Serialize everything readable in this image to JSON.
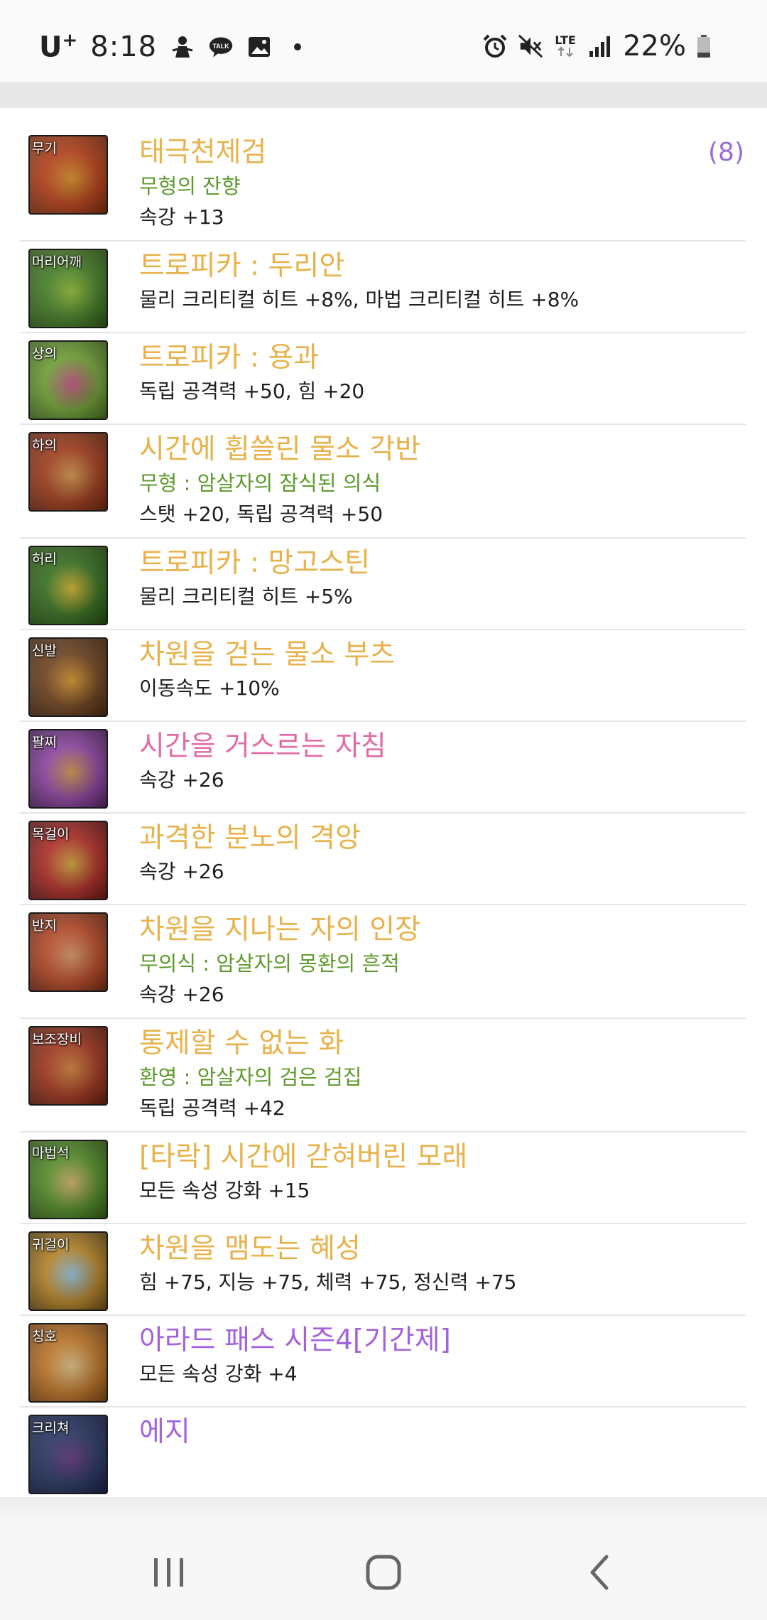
{
  "status_bar": {
    "carrier": "U",
    "carrier_sup": "+",
    "time": "8:18",
    "battery": "22%",
    "network": "LTE"
  },
  "equipment": [
    {
      "slot": "무기",
      "name": "태극천제검",
      "name_color": "gold",
      "sub": "무형의 잔향",
      "stat": "속강 +13",
      "count": "(8)",
      "icon_colors": [
        "#c8451a",
        "#e89a2a",
        "#6b2a10"
      ]
    },
    {
      "slot": "머리어깨",
      "name": "트로피카 : 두리안",
      "name_color": "gold",
      "stat": "물리 크리티컬 히트 +8%, 마법 크리티컬 히트 +8%",
      "icon_colors": [
        "#4a8a2a",
        "#9ccc3a",
        "#2a4a12"
      ]
    },
    {
      "slot": "상의",
      "name": "트로피카 : 용과",
      "name_color": "gold",
      "stat": "독립 공격력 +50, 힘 +20",
      "icon_colors": [
        "#7ab03a",
        "#d65a8a",
        "#3a5a1a"
      ]
    },
    {
      "slot": "하의",
      "name": "시간에 휩쓸린 물소 각반",
      "name_color": "gold",
      "sub": "무형 : 암살자의 잠식된 의식",
      "stat": "스탯 +20, 독립 공격력 +50",
      "icon_colors": [
        "#b0421e",
        "#e0a050",
        "#5a2010"
      ]
    },
    {
      "slot": "허리",
      "name": "트로피카 : 망고스틴",
      "name_color": "gold",
      "stat": "물리 크리티컬 히트 +5%",
      "icon_colors": [
        "#3a7a22",
        "#e0c030",
        "#22420e"
      ]
    },
    {
      "slot": "신발",
      "name": "차원을 걷는 물소 부츠",
      "name_color": "gold",
      "stat": "이동속도 +10%",
      "icon_colors": [
        "#7a4a22",
        "#e8a030",
        "#3a2010"
      ]
    },
    {
      "slot": "팔찌",
      "name": "시간을 거스르는 자침",
      "name_color": "pink",
      "stat": "속강 +26",
      "icon_colors": [
        "#9a4ab0",
        "#e0a050",
        "#3a1a4a"
      ]
    },
    {
      "slot": "목걸이",
      "name": "과격한 분노의 격앙",
      "name_color": "gold",
      "stat": "속강 +26",
      "icon_colors": [
        "#c0302a",
        "#e0b040",
        "#4a1010"
      ]
    },
    {
      "slot": "반지",
      "name": "차원을 지나는 자의 인장",
      "name_color": "gold",
      "sub": "무의식 : 암살자의 몽환의 흔적",
      "stat": "속강 +26",
      "icon_colors": [
        "#c8502a",
        "#e8a070",
        "#5a2010"
      ]
    },
    {
      "slot": "보조장비",
      "name": "통제할 수 없는 화",
      "name_color": "gold",
      "sub": "환영 : 암살자의 검은 검집",
      "stat": "독립 공격력 +42",
      "icon_colors": [
        "#b03a20",
        "#e08a40",
        "#4a1a0a"
      ]
    },
    {
      "slot": "마법석",
      "name": "[타락] 시간에 갇혀버린 모래",
      "name_color": "gold",
      "stat": "모든 속성 강화 +15",
      "icon_colors": [
        "#5a9a2a",
        "#e0c070",
        "#2a4a10"
      ]
    },
    {
      "slot": "귀걸이",
      "name": "차원을 맴도는 혜성",
      "name_color": "gold",
      "stat": "힘 +75, 지능 +75, 체력 +75, 정신력 +75",
      "icon_colors": [
        "#c8902a",
        "#a0d0f0",
        "#4a3a10"
      ]
    },
    {
      "slot": "칭호",
      "name": "아라드 패스 시즌4[기간제]",
      "name_color": "purple",
      "stat": "모든 속성 강화 +4",
      "icon_colors": [
        "#d0802a",
        "#f0d090",
        "#6a3a10"
      ]
    },
    {
      "slot": "크리쳐",
      "name": "에지",
      "name_color": "purple",
      "icon_colors": [
        "#2a3a6a",
        "#6a3a8a",
        "#101a3a"
      ]
    }
  ],
  "nav": [
    "recent-apps",
    "home",
    "back"
  ]
}
